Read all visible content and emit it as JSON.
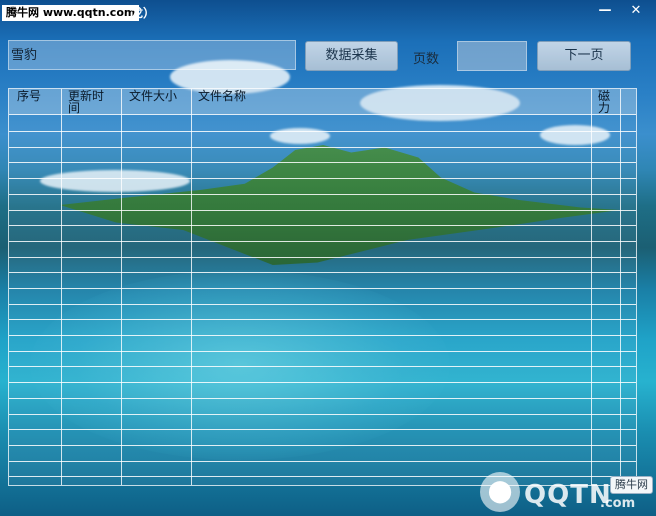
{
  "window": {
    "title_badge": "腾牛网 www.qqtn.com",
    "title_rest": "龙）",
    "minimize": "—",
    "close": "✕"
  },
  "toolbar": {
    "search_value": "雪豹",
    "collect_button": "数据采集",
    "page_label": "页数",
    "page_value": "",
    "next_button": "下一页"
  },
  "table": {
    "columns": [
      "序号",
      "更新时间",
      "文件大小",
      "文件名称",
      "磁力"
    ],
    "rows": []
  },
  "watermark": {
    "brand": "QQTN",
    "suffix": ".com",
    "badge": "腾牛网",
    "logo_icon": "tn-logo-icon"
  }
}
